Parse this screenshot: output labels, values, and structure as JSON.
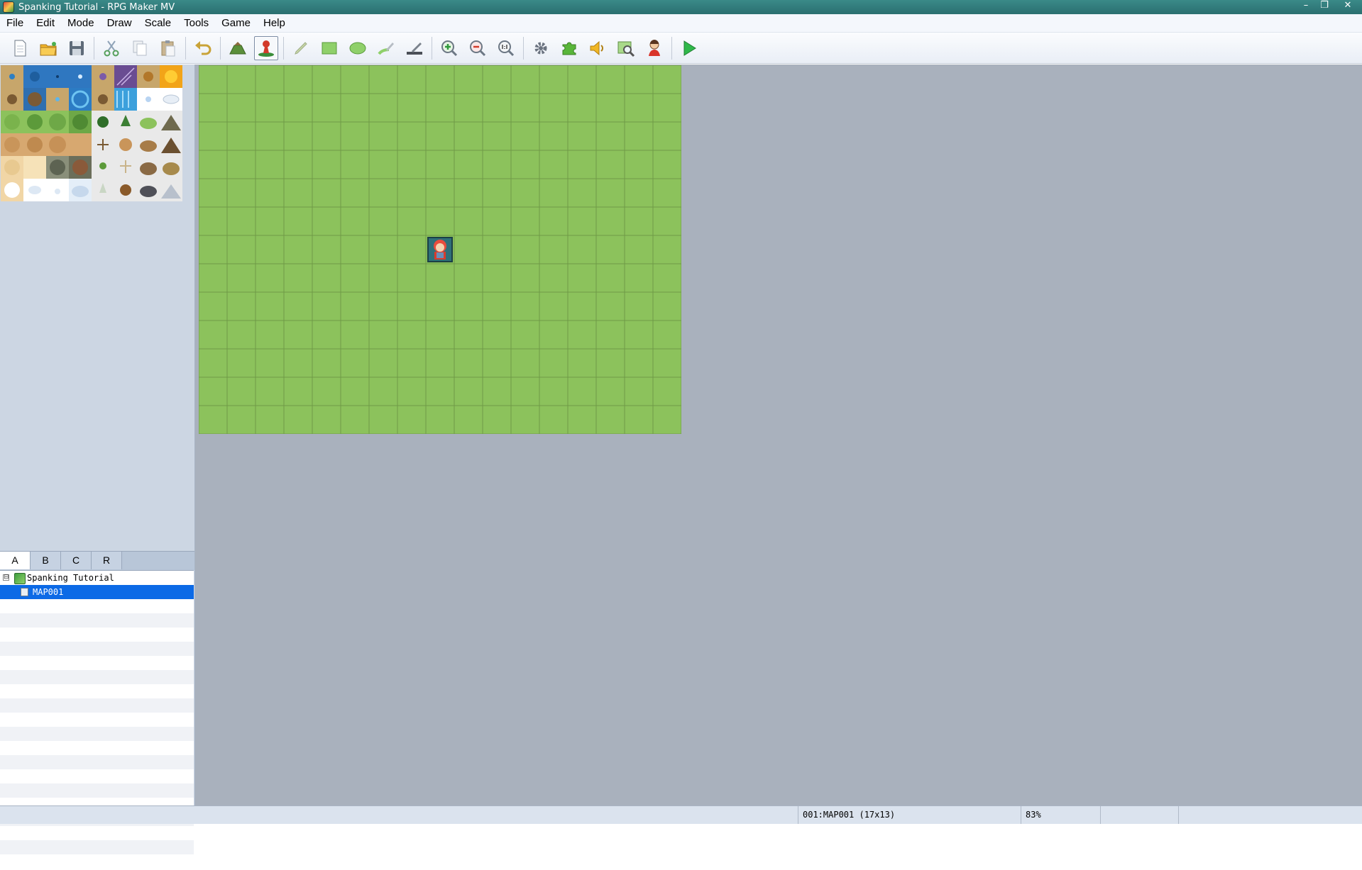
{
  "window": {
    "title": "Spanking Tutorial - RPG Maker MV",
    "minimize": "–",
    "restore": "❐",
    "close": "✕"
  },
  "menu": [
    "File",
    "Edit",
    "Mode",
    "Draw",
    "Scale",
    "Tools",
    "Game",
    "Help"
  ],
  "toolbar": {
    "icons": [
      "new-project-icon",
      "open-project-icon",
      "save-project-icon",
      "cut-icon",
      "copy-icon",
      "paste-icon",
      "undo-icon",
      "map-mode-icon",
      "event-mode-icon",
      "pencil-icon",
      "rectangle-icon",
      "ellipse-icon",
      "flood-fill-icon",
      "shadow-pen-icon",
      "zoom-in-icon",
      "zoom-out-icon",
      "zoom-actual-icon",
      "database-icon",
      "plugin-manager-icon",
      "sound-test-icon",
      "event-searcher-icon",
      "character-generator-icon",
      "playtest-icon"
    ],
    "active": "event-mode-icon"
  },
  "tileset_tabs": [
    "A",
    "B",
    "C",
    "R"
  ],
  "tileset_selected_tab": "A",
  "tree": {
    "project": "Spanking Tutorial",
    "expander": "⊟",
    "maps": [
      "MAP001"
    ],
    "selected": "MAP001"
  },
  "map": {
    "columns": 17,
    "rows": 13,
    "player_start": [
      8,
      6
    ],
    "grass_color": "#8cc25c",
    "grid_color": "#6f9a47"
  },
  "status": {
    "map_info": "001:MAP001 (17x13)",
    "zoom": "83%"
  }
}
